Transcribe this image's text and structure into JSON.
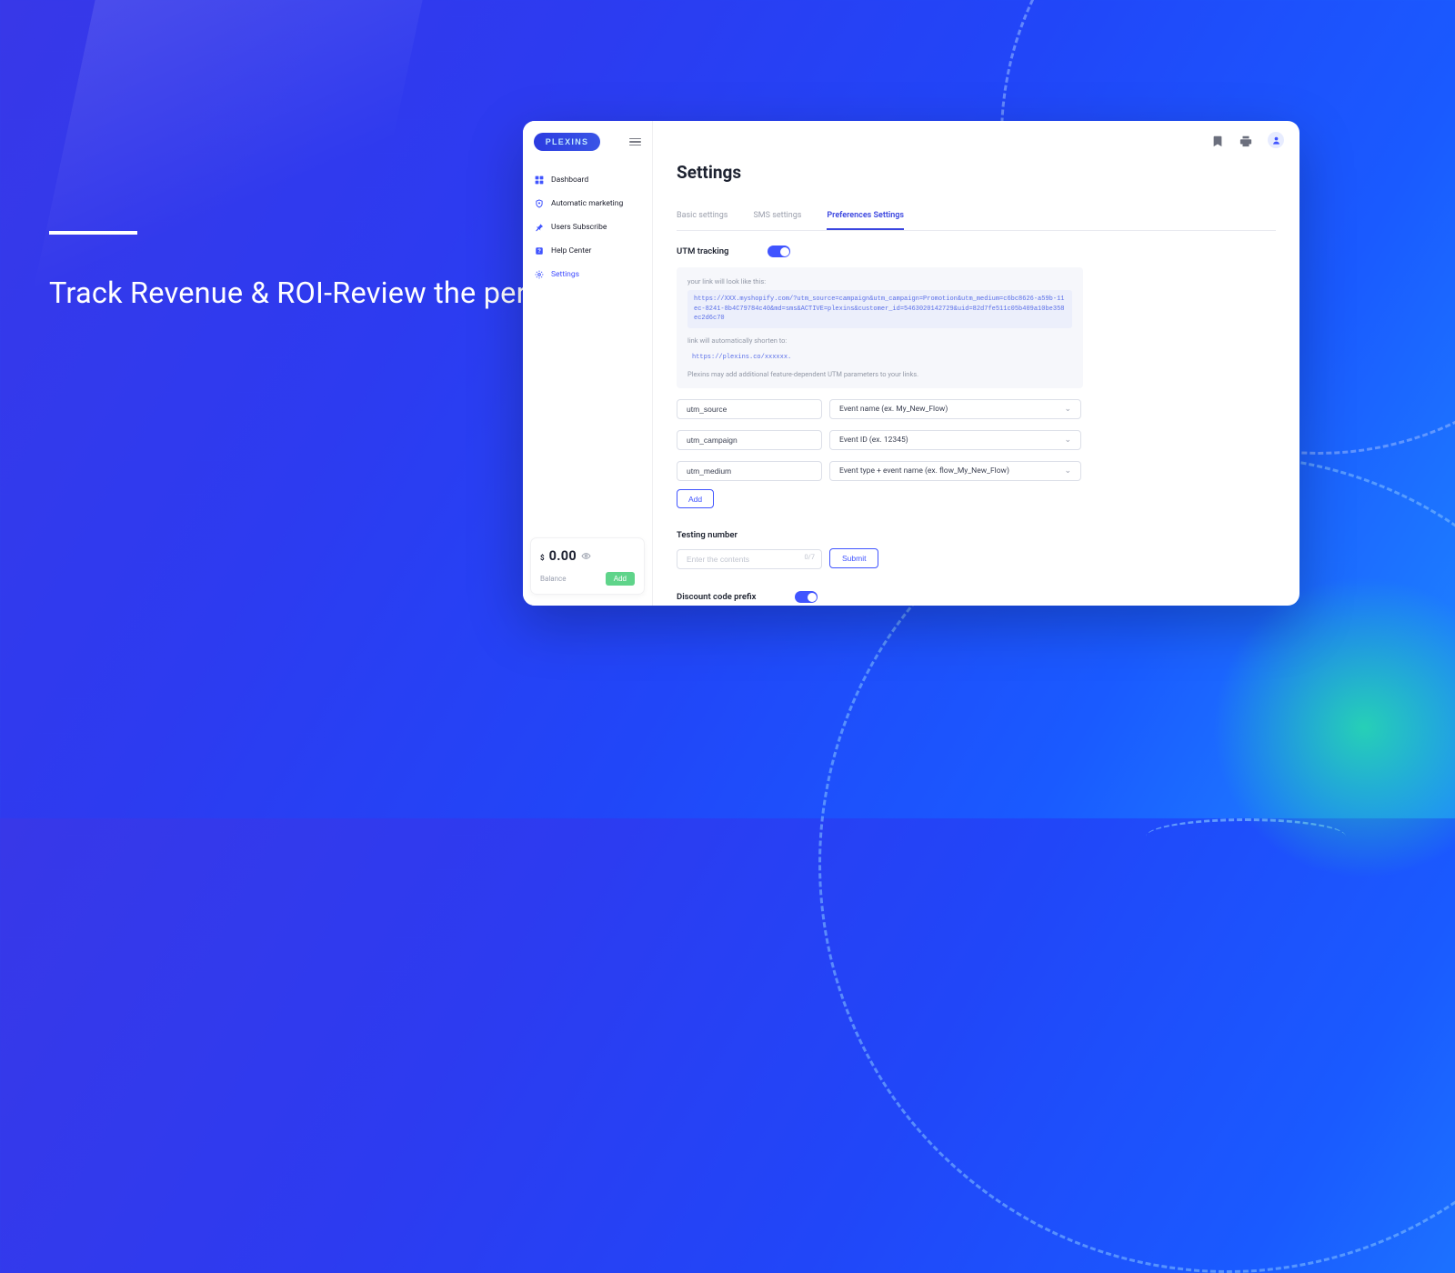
{
  "hero": {
    "headline": "Track Revenue & ROI-Review the performance of your sms messages."
  },
  "logo": {
    "text": "PLEXINS"
  },
  "sidebar": {
    "items": [
      {
        "label": "Dashboard"
      },
      {
        "label": "Automatic marketing"
      },
      {
        "label": "Users Subscribe"
      },
      {
        "label": "Help Center"
      },
      {
        "label": "Settings"
      }
    ]
  },
  "balance": {
    "currency": "$",
    "value": "0.00",
    "label": "Balance",
    "add": "Add"
  },
  "page": {
    "title": "Settings",
    "tabs": [
      {
        "label": "Basic settings"
      },
      {
        "label": "SMS settings"
      },
      {
        "label": "Preferences Settings"
      }
    ]
  },
  "utm": {
    "title": "UTM tracking",
    "look_label": "your link will look like this:",
    "example_url": "https://XXX.myshopify.com/?utm_source=campaign&utm_campaign=Promotion&utm_medium=c6bc8626-a59b-11ec-8241-8b4C79784c40&md=sms&ACTIVE=plexins&customer_id=5463020142729&uid=82d7fe511c05b409a10be358ec2d6c70",
    "shorten_label": "link will automatically shorten to:",
    "short_url": "https://plexins.co/xxxxxx.",
    "note": "Plexins may add additional feature-dependent UTM parameters to your links.",
    "rows": [
      {
        "key": "utm_source",
        "value": "Event name (ex. My_New_Flow)"
      },
      {
        "key": "utm_campaign",
        "value": "Event ID (ex. 12345)"
      },
      {
        "key": "utm_medium",
        "value": "Event type + event name (ex. flow_My_New_Flow)"
      }
    ],
    "add": "Add"
  },
  "testing": {
    "title": "Testing number",
    "placeholder": "Enter the contents",
    "counter": "0/7",
    "submit": "Submit"
  },
  "discount": {
    "title": "Discount code prefix"
  }
}
